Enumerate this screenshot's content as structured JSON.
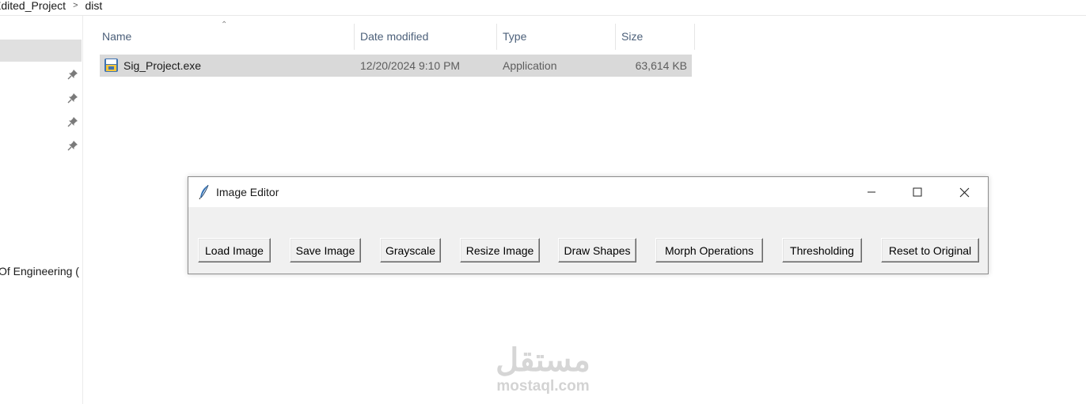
{
  "explorer": {
    "breadcrumb": {
      "segment1": "Edited_Project",
      "separator": ">",
      "segment2": "dist"
    },
    "nav": {
      "partial_item": "Of Engineering ("
    },
    "columns": {
      "name": "Name",
      "date": "Date modified",
      "type": "Type",
      "size": "Size"
    },
    "files": [
      {
        "name": "Sig_Project.exe",
        "date": "12/20/2024 9:10 PM",
        "type": "Application",
        "size": "63,614 KB",
        "icon": "python-exe-icon"
      }
    ]
  },
  "image_editor": {
    "title": "Image Editor",
    "title_icon": "tk-feather-icon",
    "buttons": {
      "load": "Load Image",
      "save": "Save Image",
      "grayscale": "Grayscale",
      "resize": "Resize Image",
      "draw": "Draw Shapes",
      "morph": "Morph Operations",
      "threshold": "Thresholding",
      "reset": "Reset to Original"
    }
  },
  "watermark": {
    "arabic": "مستقل",
    "latin": "mostaql.com"
  },
  "colors": {
    "selection": "#d9d9d9",
    "header_text": "#4c607a",
    "tk_background": "#f0f0f0"
  }
}
